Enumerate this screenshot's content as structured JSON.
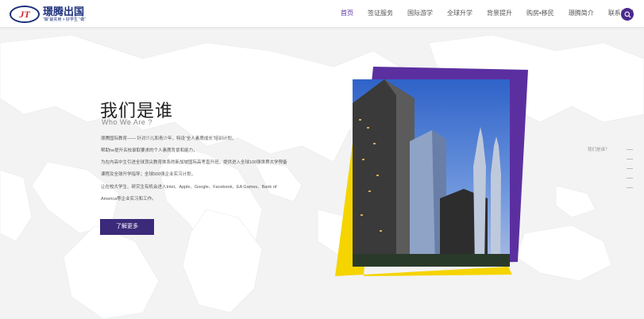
{
  "brand": {
    "mark": "JT",
    "name": "璟腾出国",
    "slogan": "“做”最实用 > 好学生 “做”"
  },
  "nav": {
    "items": [
      {
        "label": "首页",
        "active": true
      },
      {
        "label": "签证服务",
        "active": false
      },
      {
        "label": "国际游学",
        "active": false
      },
      {
        "label": "全球升学",
        "active": false
      },
      {
        "label": "背景提升",
        "active": false
      },
      {
        "label": "购房•移民",
        "active": false
      },
      {
        "label": "璟腾简介",
        "active": false
      },
      {
        "label": "联系我们",
        "active": false
      }
    ],
    "search_icon": "search-icon"
  },
  "about": {
    "title": "我们是谁",
    "subtitle": "Who We Are ?",
    "lines": [
      "璟腾国际教育—— 针对少儿和青少年，特设“全人素质成长”培训计划，",
      "帮助he提升名校录取要求的个人素质背景和能力，",
      "为在内高中生引进全球顶尖教育体系的新加坡国际高考直升班，提供进入全球100强世界大学预备",
      "课程及全球升学指导；全球500强企业实习计划，",
      "让在校大学生、研究生有机会进入Intel、Apple、Google、Facebook、EA Games、Bank of",
      "America等企业实习和工作。"
    ],
    "more_label": "了解更多"
  },
  "side": {
    "label": "我们是谁？"
  },
  "colors": {
    "accent": "#4a2a8c",
    "purple_frame": "#5b2fa0",
    "yellow_frame": "#f5d400"
  }
}
